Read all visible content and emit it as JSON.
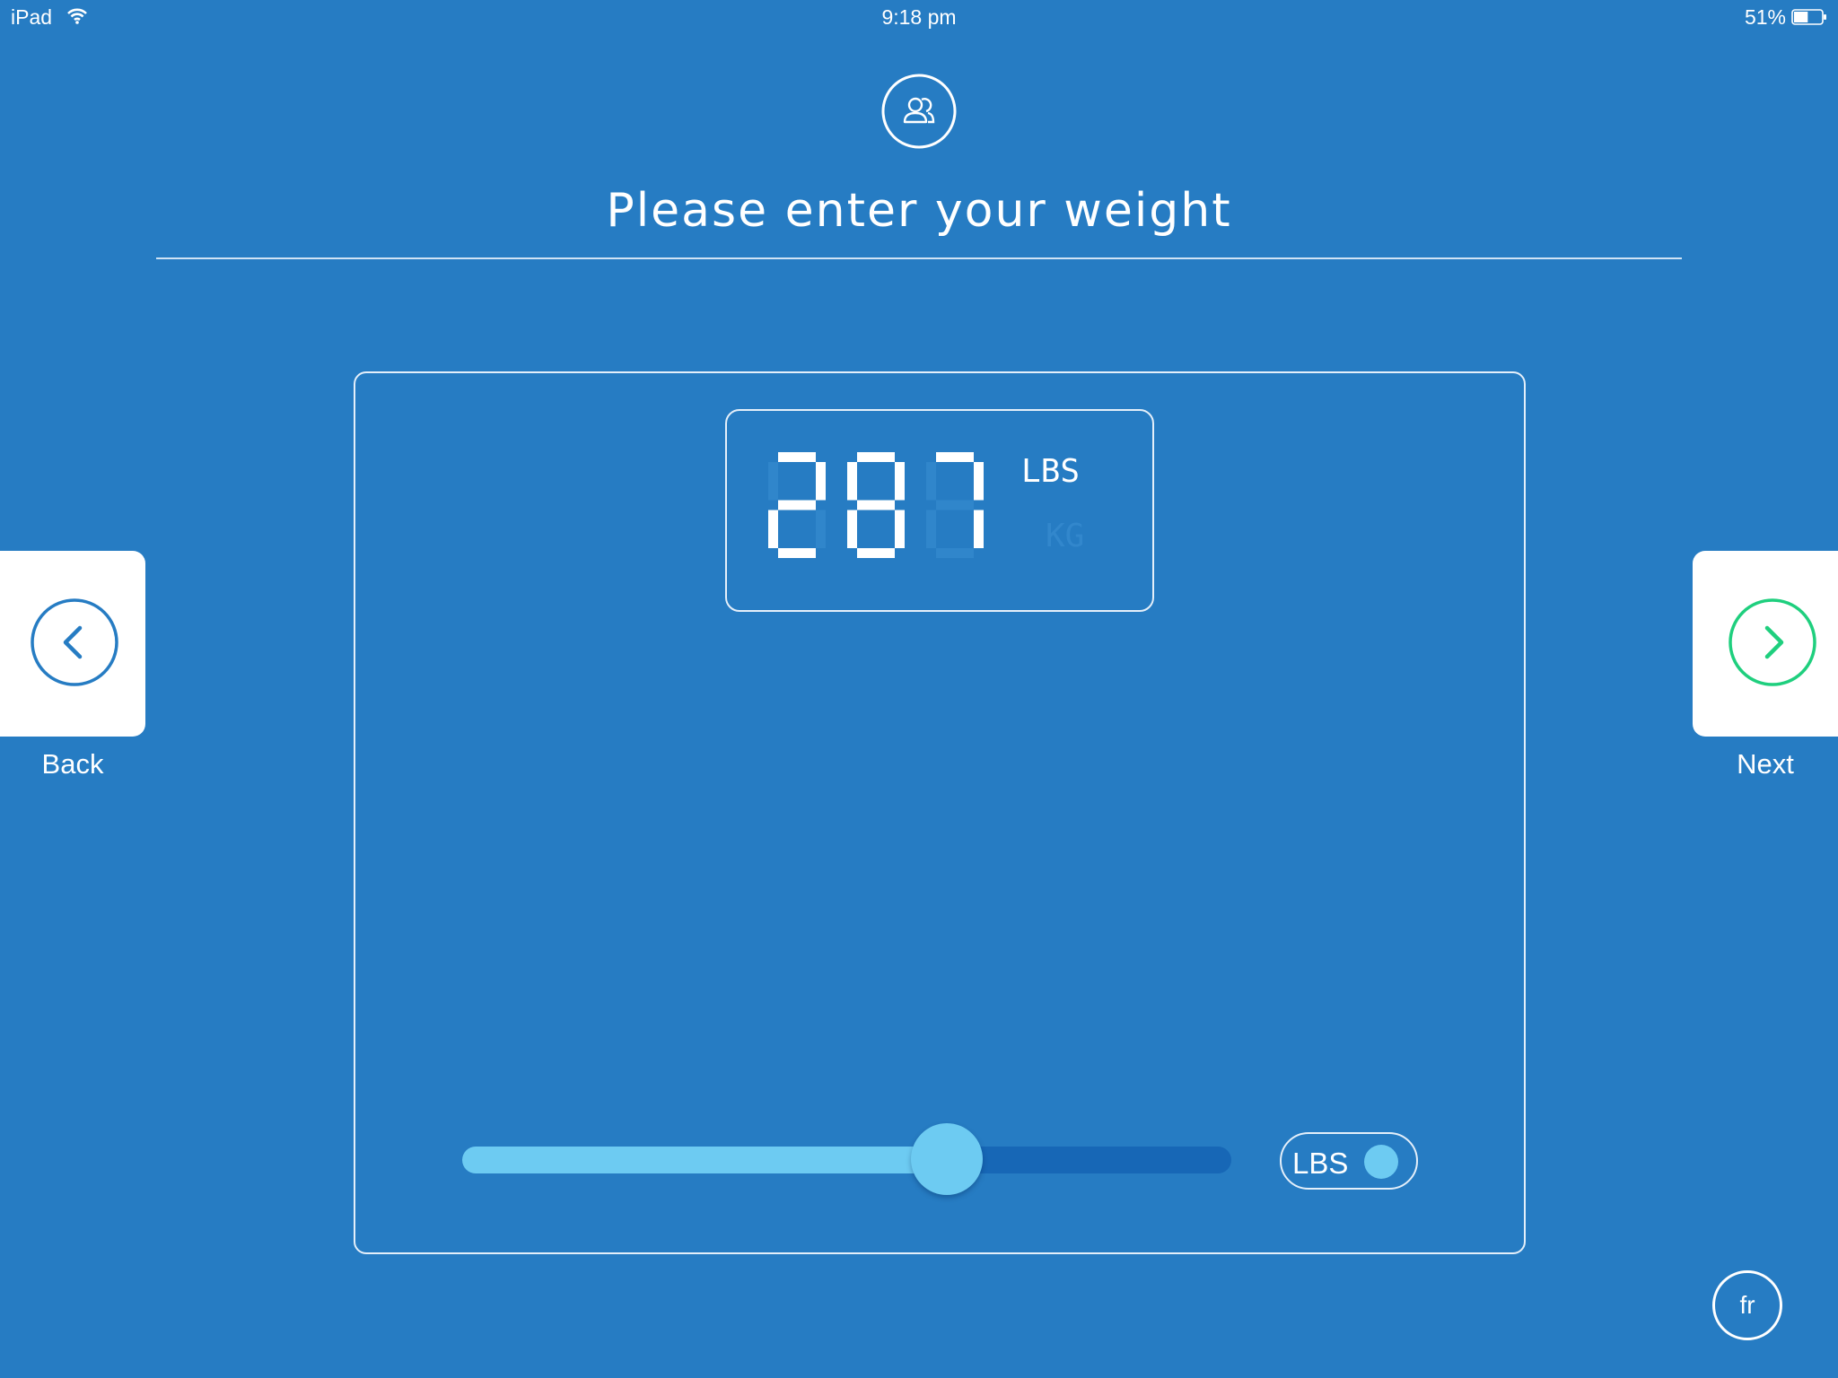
{
  "status_bar": {
    "device": "iPad",
    "time": "9:18 pm",
    "battery": "51%",
    "battery_level": 0.51
  },
  "header": {
    "title": "Please enter your weight",
    "icon": "user-group-icon"
  },
  "navigation": {
    "back_label": "Back",
    "next_label": "Next",
    "back_icon": "chevron-left-icon",
    "next_icon": "chevron-right-icon",
    "next_color": "#1fcf7e",
    "back_color": "#267cc3"
  },
  "scale": {
    "weight": "287",
    "unit_lbs": "LBS",
    "unit_kg": "KG",
    "active_unit": "LBS",
    "slider_level": 0.63
  },
  "unit_toggle": {
    "label": "LBS"
  },
  "language_button": {
    "label": "fr"
  },
  "colors": {
    "background": "#267cc3",
    "accent": "#6dcbf2",
    "track": "#1767b6"
  }
}
